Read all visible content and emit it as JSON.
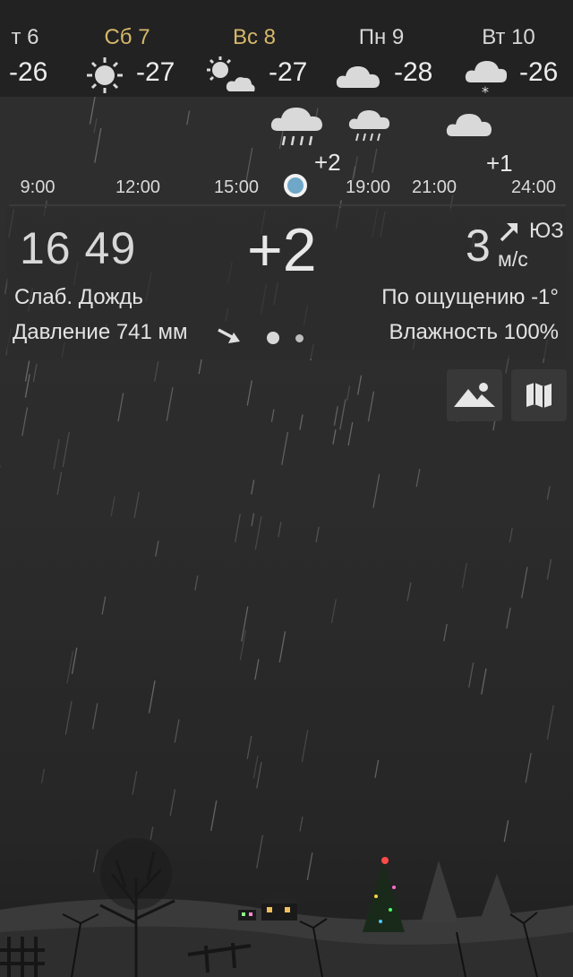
{
  "forecast": {
    "days": [
      {
        "label": "т 6",
        "temp": "-26",
        "icon": "none",
        "weekend": false
      },
      {
        "label": "Сб 7",
        "temp": "-27",
        "icon": "sun-icon",
        "weekend": true
      },
      {
        "label": "Вс 8",
        "temp": "-27",
        "icon": "sun-cloud-icon",
        "weekend": true
      },
      {
        "label": "Пн 9",
        "temp": "-28",
        "icon": "cloud-icon",
        "weekend": false
      },
      {
        "label": "Вт 10",
        "temp": "-26",
        "icon": "cloud-snow-icon",
        "weekend": false
      }
    ]
  },
  "hourly": {
    "temps": [
      "+2",
      "+1"
    ],
    "hours": [
      "9:00",
      "12:00",
      "15:00",
      "19:00",
      "21:00",
      "24:00"
    ]
  },
  "current": {
    "time": "16 49",
    "temperature": "+2",
    "wind_speed": "3",
    "wind_direction": "ЮЗ",
    "wind_unit": "м/с",
    "condition": "Слаб. Дождь",
    "feels_like": "По ощущению -1°",
    "pressure": "Давление 741 мм",
    "humidity": "Влажность 100%",
    "page_count": 2,
    "active_page": 1
  },
  "buttons": {
    "landscape": "landscape-icon",
    "map": "map-icon"
  },
  "colors": {
    "background": "#2b2b2b",
    "weekend": "#d7b76a",
    "now_dot": "#6fa7c8"
  }
}
